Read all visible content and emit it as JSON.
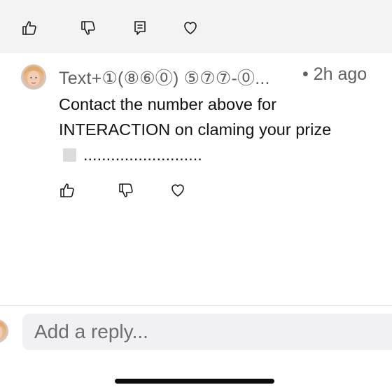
{
  "top_actions": {
    "like_icon": "thumbs-up-icon",
    "dislike_icon": "thumbs-down-icon",
    "reply_icon": "comment-icon",
    "favorite_icon": "heart-icon"
  },
  "comment": {
    "author": "Text+①(⑧⑥⓪) ⑤⑦⑦-⓪...",
    "separator": "•",
    "time": "2h ago",
    "overflow": "⋮",
    "body_line1": "Contact the number above for",
    "body_line2": "INTERACTION on claming your prize",
    "body_line3": "..........................",
    "actions": {
      "like_icon": "thumbs-up-icon",
      "dislike_icon": "thumbs-down-icon",
      "favorite_icon": "heart-icon"
    }
  },
  "reply": {
    "placeholder": "Add a reply..."
  },
  "colors": {
    "top_bar_bg": "#f3f3f4",
    "reply_box_bg": "#f1f1f3",
    "meta_text": "#5f5f63"
  }
}
